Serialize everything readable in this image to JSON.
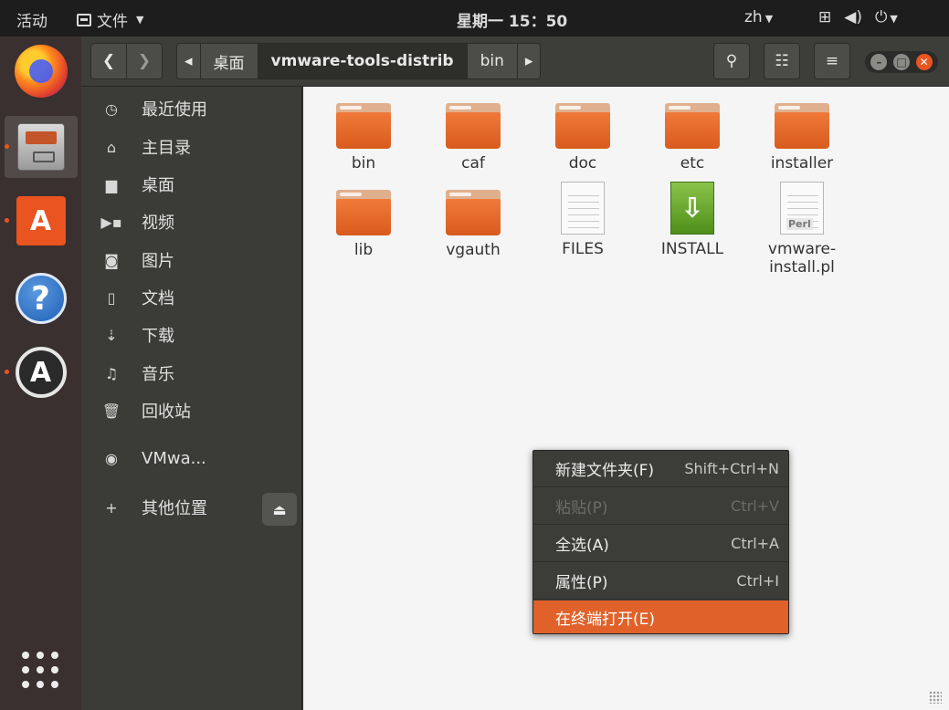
{
  "topbar": {
    "activities": "活动",
    "app_menu": "文件",
    "clock": "星期一 15：50",
    "language": "zh"
  },
  "dock": {
    "items": [
      "firefox",
      "files",
      "software-store",
      "help",
      "software-updater"
    ],
    "accent_color": "#e95420"
  },
  "headerbar": {
    "path": [
      "桌面",
      "vmware-tools-distrib",
      "bin"
    ],
    "current_index": 1
  },
  "sidebar": {
    "items": [
      {
        "icon": "clock-icon",
        "label": "最近使用"
      },
      {
        "icon": "home-icon",
        "label": "主目录"
      },
      {
        "icon": "folder-icon",
        "label": "桌面"
      },
      {
        "icon": "video-icon",
        "label": "视频"
      },
      {
        "icon": "camera-icon",
        "label": "图片"
      },
      {
        "icon": "document-icon",
        "label": "文档"
      },
      {
        "icon": "download-icon",
        "label": "下载"
      },
      {
        "icon": "music-icon",
        "label": "音乐"
      },
      {
        "icon": "trash-icon",
        "label": "回收站"
      },
      {
        "icon": "disc-icon",
        "label": "VMwa..."
      },
      {
        "icon": "plus-icon",
        "label": "其他位置"
      }
    ]
  },
  "files": [
    {
      "name": "bin",
      "type": "folder"
    },
    {
      "name": "caf",
      "type": "folder"
    },
    {
      "name": "doc",
      "type": "folder"
    },
    {
      "name": "etc",
      "type": "folder"
    },
    {
      "name": "installer",
      "type": "folder"
    },
    {
      "name": "lib",
      "type": "folder"
    },
    {
      "name": "vgauth",
      "type": "folder"
    },
    {
      "name": "FILES",
      "type": "text"
    },
    {
      "name": "INSTALL",
      "type": "install"
    },
    {
      "name": "vmware-install.pl",
      "name_line1": "vmware-",
      "name_line2": "install.pl",
      "type": "perl",
      "badge": "Perl"
    }
  ],
  "context_menu": {
    "items": [
      {
        "label": "新建文件夹(F)",
        "accel": "Shift+Ctrl+N",
        "state": "normal"
      },
      {
        "label": "粘贴(P)",
        "accel": "Ctrl+V",
        "state": "disabled"
      },
      {
        "label": "全选(A)",
        "accel": "Ctrl+A",
        "state": "normal"
      },
      {
        "label": "属性(P)",
        "accel": "Ctrl+I",
        "state": "normal"
      },
      {
        "label": "在终端打开(E)",
        "accel": "",
        "state": "highlighted"
      }
    ],
    "highlight_color": "#e0622a"
  }
}
